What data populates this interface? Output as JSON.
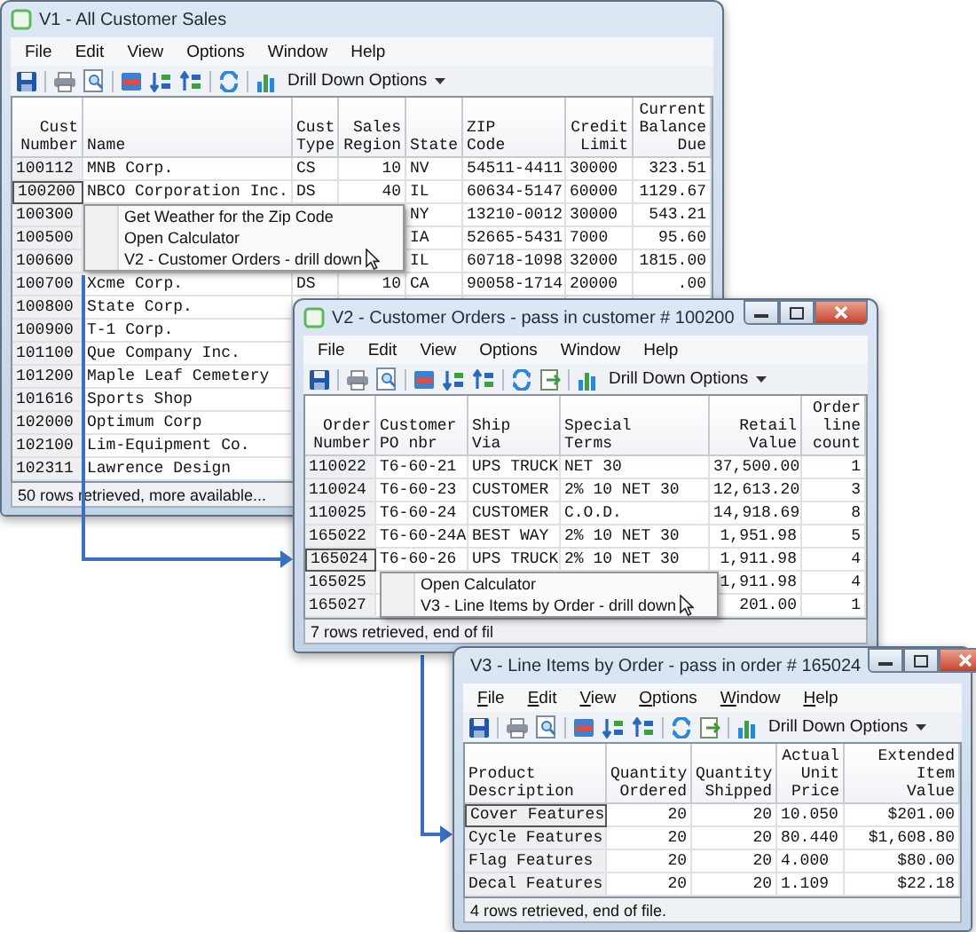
{
  "windows": [
    {
      "title": "V1 - All Customer Sales",
      "controls": false,
      "underline_access_keys": false,
      "menus": [
        "File",
        "Edit",
        "View",
        "Options",
        "Window",
        "Help"
      ],
      "toolbar": {
        "export_icon": false,
        "label": "Drill Down Options"
      },
      "columns": [
        "Cust\nNumber",
        "Name",
        "Cust\nType",
        "Sales\nRegion",
        "State",
        "ZIP\nCode",
        "Credit\nLimit",
        "Current\nBalance\nDue"
      ],
      "rows": [
        {
          "selected": false,
          "cells": [
            "100112",
            "MNB Corp.",
            "CS",
            "10",
            "NV",
            "54511-4411",
            "30000",
            "323.51"
          ]
        },
        {
          "selected": true,
          "cells": [
            "100200",
            "NBCO Corporation Inc.",
            "DS",
            "40",
            "IL",
            "60634-5147",
            "60000",
            "1129.67"
          ]
        },
        {
          "selected": false,
          "cells": [
            "100300",
            null,
            null,
            null,
            "NY",
            "13210-0012",
            "30000",
            "543.21"
          ]
        },
        {
          "selected": false,
          "cells": [
            "100500",
            null,
            null,
            null,
            "IA",
            "52665-5431",
            "7000",
            "95.60"
          ]
        },
        {
          "selected": false,
          "cells": [
            "100600",
            null,
            null,
            null,
            "IL",
            "60718-1098",
            "32000",
            "1815.00"
          ]
        },
        {
          "selected": false,
          "cells": [
            "100700",
            "Xcme Corp.",
            "DS",
            "10",
            "CA",
            "90058-1714",
            "20000",
            ".00"
          ]
        },
        {
          "selected": false,
          "cells": [
            "100800",
            "State Corp."
          ]
        },
        {
          "selected": false,
          "cells": [
            "100900",
            "T-1 Corp."
          ]
        },
        {
          "selected": false,
          "cells": [
            "101100",
            "Que Company Inc."
          ]
        },
        {
          "selected": false,
          "cells": [
            "101200",
            "Maple Leaf Cemetery"
          ]
        },
        {
          "selected": false,
          "cells": [
            "101616",
            "Sports Shop"
          ]
        },
        {
          "selected": false,
          "cells": [
            "102000",
            "Optimum Corp"
          ]
        },
        {
          "selected": false,
          "cells": [
            "102100",
            "Lim-Equipment Co."
          ]
        },
        {
          "selected": false,
          "cells": [
            "102311",
            "Lawrence Design"
          ]
        }
      ],
      "status": "50 rows retrieved, more available..."
    },
    {
      "title": "V2 - Customer Orders - pass in customer # 100200",
      "controls": true,
      "underline_access_keys": false,
      "menus": [
        "File",
        "Edit",
        "View",
        "Options",
        "Window",
        "Help"
      ],
      "toolbar": {
        "export_icon": true,
        "label": "Drill Down Options"
      },
      "columns": [
        "Order\nNumber",
        "Customer\nPO nbr",
        "Ship\nVia",
        "Special\nTerms",
        "Retail\nValue",
        "Order\nline\ncount"
      ],
      "rows": [
        {
          "selected": false,
          "cells": [
            "110022",
            "T6-60-21",
            "UPS TRUCK",
            "NET 30",
            "37,500.00",
            "1"
          ]
        },
        {
          "selected": false,
          "cells": [
            "110024",
            "T6-60-23",
            "CUSTOMER",
            "2% 10 NET 30",
            "12,613.20",
            "3"
          ]
        },
        {
          "selected": false,
          "cells": [
            "110025",
            "T6-60-24",
            "CUSTOMER",
            "C.O.D.",
            "14,918.69",
            "8"
          ]
        },
        {
          "selected": false,
          "cells": [
            "165022",
            "T6-60-24A",
            "BEST WAY",
            "2% 10 NET 30",
            "1,951.98",
            "5"
          ]
        },
        {
          "selected": true,
          "cells": [
            "165024",
            "T6-60-26",
            "UPS TRUCK",
            "2% 10 NET 30",
            "1,911.98",
            "4"
          ]
        },
        {
          "selected": false,
          "cells": [
            "165025",
            null,
            null,
            null,
            "1,911.98",
            "4"
          ]
        },
        {
          "selected": false,
          "cells": [
            "165027",
            null,
            null,
            null,
            "201.00",
            "1"
          ]
        }
      ],
      "status": "7 rows retrieved, end of fil"
    },
    {
      "title": "V3 - Line Items by Order - pass in order # 165024",
      "controls": true,
      "underline_access_keys": true,
      "menus": [
        "File",
        "Edit",
        "View",
        "Options",
        "Window",
        "Help"
      ],
      "toolbar": {
        "export_icon": true,
        "label": "Drill Down Options"
      },
      "columns": [
        "Product\nDescription",
        "Quantity\nOrdered",
        "Quantity\nShipped",
        "Actual\nUnit\nPrice",
        "Extended\nItem\nValue"
      ],
      "rows": [
        {
          "selected": true,
          "cells": [
            "Cover Features",
            "20",
            "20",
            "10.050",
            "$201.00"
          ]
        },
        {
          "selected": false,
          "cells": [
            "Cycle Features",
            "20",
            "20",
            "80.440",
            "$1,608.80"
          ]
        },
        {
          "selected": false,
          "cells": [
            "Flag Features",
            "20",
            "20",
            "4.000",
            "$80.00"
          ]
        },
        {
          "selected": false,
          "cells": [
            "Decal Features",
            "20",
            "20",
            "1.109",
            "$22.18"
          ]
        }
      ],
      "status": "4 rows retrieved, end of file."
    }
  ],
  "context_menus": [
    {
      "items": [
        {
          "label": "Get Weather for the Zip Code",
          "pointer": false
        },
        {
          "label": "Open Calculator",
          "pointer": false
        },
        {
          "label": "V2 - Customer Orders - drill down",
          "pointer": true
        }
      ]
    },
    {
      "items": [
        {
          "label": "Open Calculator",
          "pointer": false
        },
        {
          "label": "V3 - Line Items by Order - drill down",
          "pointer": true
        }
      ]
    }
  ]
}
